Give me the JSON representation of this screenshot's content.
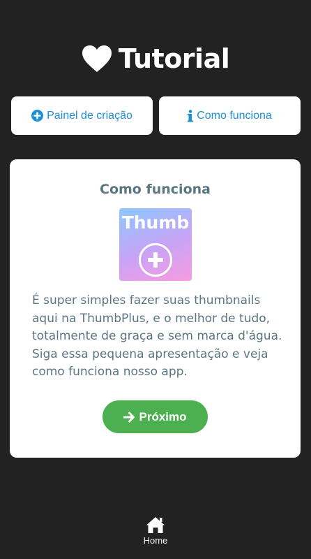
{
  "header": {
    "title": "Tutorial",
    "icon": "heart-icon"
  },
  "tabs": [
    {
      "label": "Painel de criação",
      "icon": "plus-circle-icon"
    },
    {
      "label": "Como funciona",
      "icon": "info-icon"
    }
  ],
  "card": {
    "title": "Como funciona",
    "logo_text": "Thumb",
    "description": "É super simples fazer suas thumbnails aqui na ThumbPlus, e o melhor de tudo, totalmente de graça e sem marca d'água. Siga essa pequena apresentação e veja como funciona nosso app.",
    "next_label": "Próximo",
    "next_icon": "arrow-right-icon"
  },
  "bottom_nav": {
    "home_label": "Home",
    "icon": "home-icon"
  },
  "colors": {
    "background": "#222222",
    "accent_blue": "#1a8fd6",
    "text_gray": "#5b7683",
    "button_green": "#4caf50"
  }
}
